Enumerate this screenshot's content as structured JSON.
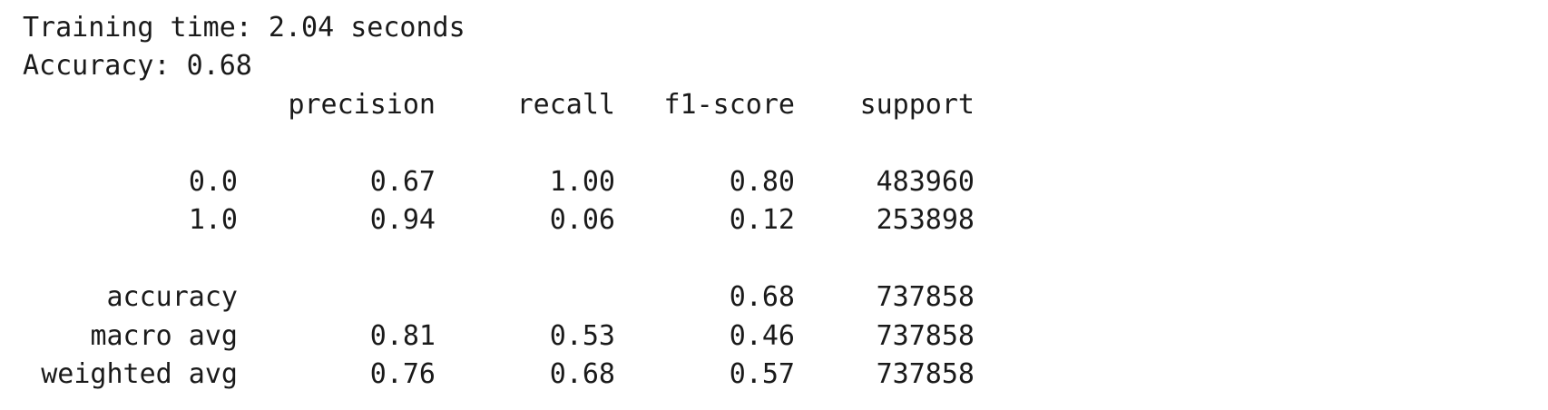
{
  "summary": {
    "training_time": "Training time: 2.04 seconds",
    "accuracy": "Accuracy: 0.68"
  },
  "report": {
    "headers": [
      "precision",
      "recall",
      "f1-score",
      "support"
    ],
    "class_rows": [
      {
        "label": "0.0",
        "precision": "0.67",
        "recall": "1.00",
        "f1": "0.80",
        "support": "483960"
      },
      {
        "label": "1.0",
        "precision": "0.94",
        "recall": "0.06",
        "f1": "0.12",
        "support": "253898"
      }
    ],
    "accuracy_row": {
      "label": "accuracy",
      "f1": "0.68",
      "support": "737858"
    },
    "avg_rows": [
      {
        "label": "macro avg",
        "precision": "0.81",
        "recall": "0.53",
        "f1": "0.46",
        "support": "737858"
      },
      {
        "label": "weighted avg",
        "precision": "0.76",
        "recall": "0.68",
        "f1": "0.57",
        "support": "737858"
      }
    ]
  }
}
